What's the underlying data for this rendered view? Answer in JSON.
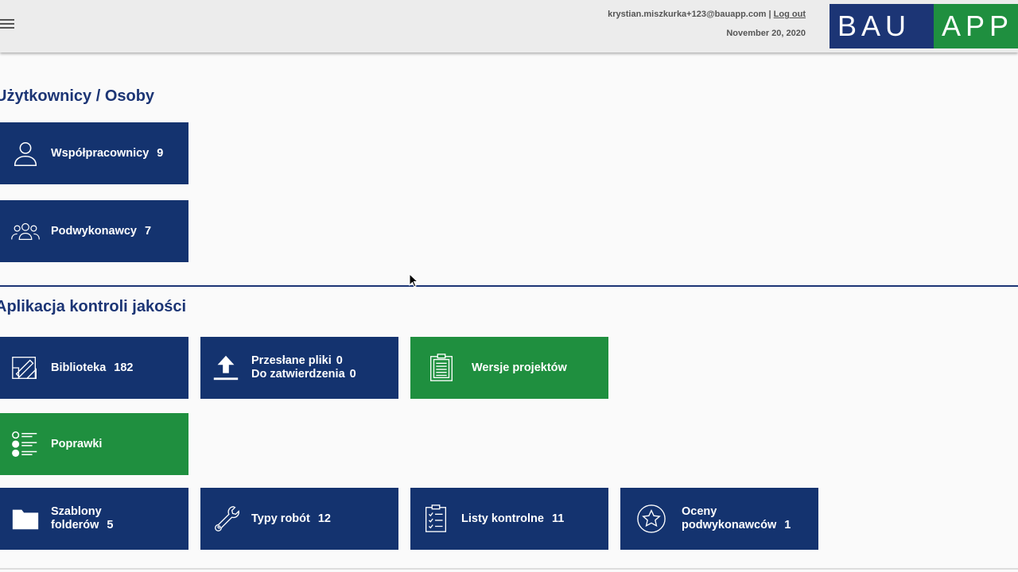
{
  "header": {
    "user_email": "krystian.miszkurka+123@bauapp.com",
    "separator": "|",
    "logout_label": "Log out",
    "date": "November 20, 2020",
    "logo_left": "BAU",
    "logo_right": "APP"
  },
  "sections": {
    "users": {
      "title": "Użytkownicy / Osoby",
      "tiles": [
        {
          "label": "Współpracownicy",
          "count": "9",
          "icon": "user-icon"
        },
        {
          "label": "Podwykonawcy",
          "count": "7",
          "icon": "group-icon"
        }
      ]
    },
    "quality": {
      "title": "Aplikacja kontroli jakości",
      "tiles": [
        {
          "label": "Biblioteka",
          "count": "182",
          "icon": "blueprint-icon"
        },
        {
          "label1": "Przesłane pliki",
          "count1": "0",
          "label2": "Do zatwierdzenia",
          "count2": "0",
          "icon": "upload-icon"
        },
        {
          "label": "Wersje projektów",
          "icon": "clipboard-list-icon"
        },
        {
          "label": "Poprawki",
          "icon": "list-icon"
        },
        {
          "label1": "Szablony",
          "label2": "folderów",
          "count": "5",
          "icon": "folder-icon"
        },
        {
          "label": "Typy robót",
          "count": "12",
          "icon": "wrench-icon"
        },
        {
          "label": "Listy kontrolne",
          "count": "11",
          "icon": "checklist-icon"
        },
        {
          "label1": "Oceny",
          "label2": "podwykonawców",
          "count": "1",
          "icon": "star-icon"
        }
      ]
    }
  },
  "colors": {
    "tile_blue": "#14336f",
    "tile_green": "#1f8f3f",
    "title_blue": "#1c3575"
  }
}
